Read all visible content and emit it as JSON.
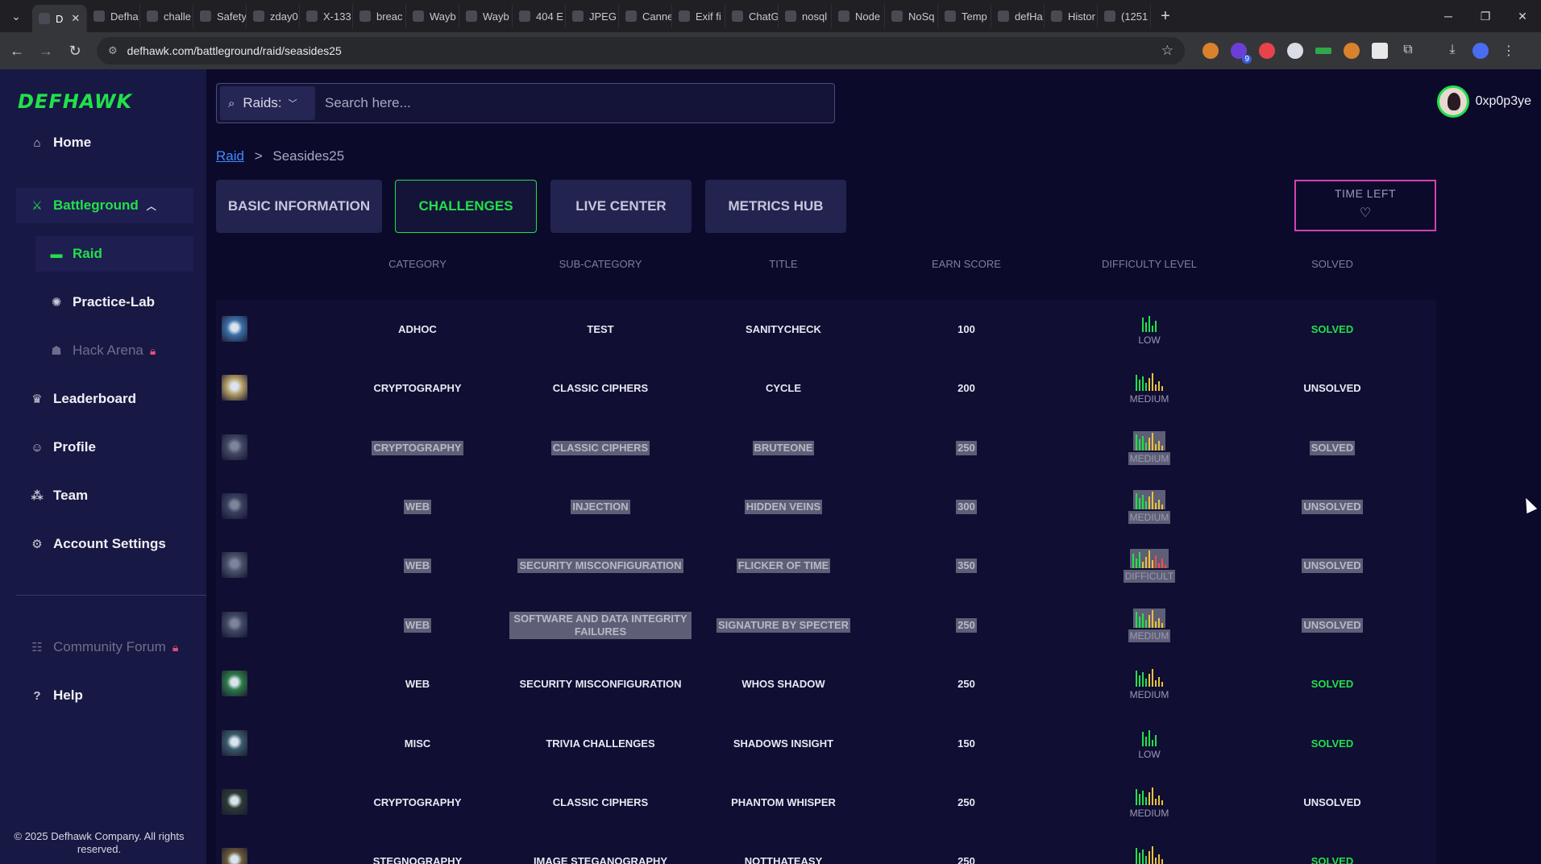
{
  "browser": {
    "tabs": [
      {
        "label": "D",
        "active": true
      },
      {
        "label": "Defha"
      },
      {
        "label": "challe"
      },
      {
        "label": "Safety wa"
      },
      {
        "label": "zday0"
      },
      {
        "label": "X-133"
      },
      {
        "label": "breac"
      },
      {
        "label": "Wayb"
      },
      {
        "label": "Wayb"
      },
      {
        "label": "404 E"
      },
      {
        "label": "JPEG i"
      },
      {
        "label": "Canne"
      },
      {
        "label": "Exif fi"
      },
      {
        "label": "ChatG"
      },
      {
        "label": "nosql"
      },
      {
        "label": "Node"
      },
      {
        "label": "NoSq"
      },
      {
        "label": "Temp"
      },
      {
        "label": "defHa"
      },
      {
        "label": "Histor"
      },
      {
        "label": "(1251"
      }
    ],
    "url": "defhawk.com/battleground/raid/seasides25",
    "extension_badge": "9"
  },
  "brand": {
    "logo": "DEFHAWK",
    "accent": "#22e04a",
    "highlight_border": "#d640b0"
  },
  "sidebar": {
    "items": [
      {
        "label": "Home",
        "icon": "home-icon"
      },
      {
        "label": "Battleground",
        "icon": "battleground-icon",
        "expanded": true
      },
      {
        "label": "Raid",
        "icon": "raid-icon",
        "active": true
      },
      {
        "label": "Practice-Lab",
        "icon": "practice-lab-icon"
      },
      {
        "label": "Hack Arena",
        "icon": "hack-arena-icon",
        "locked": true
      },
      {
        "label": "Leaderboard",
        "icon": "leaderboard-icon"
      },
      {
        "label": "Profile",
        "icon": "profile-icon"
      },
      {
        "label": "Team",
        "icon": "team-icon"
      },
      {
        "label": "Account Settings",
        "icon": "gear-icon"
      },
      {
        "label": "Community Forum",
        "icon": "forum-icon",
        "locked": true
      },
      {
        "label": "Help",
        "icon": "help-icon"
      }
    ],
    "footer": "© 2025 Defhawk Company. All rights reserved."
  },
  "search": {
    "scope": "Raids:",
    "placeholder": "Search here..."
  },
  "user": {
    "name": "0xp0p3ye"
  },
  "breadcrumb": {
    "parent": "Raid",
    "separator": ">",
    "current": "Seasides25"
  },
  "page_tabs": [
    {
      "label": "BASIC INFORMATION"
    },
    {
      "label": "CHALLENGES",
      "active": true
    },
    {
      "label": "LIVE CENTER"
    },
    {
      "label": "METRICS HUB"
    }
  ],
  "time_left": {
    "label": "TIME LEFT"
  },
  "table": {
    "headers": [
      "CATEGORY",
      "SUB-CATEGORY",
      "TITLE",
      "EARN SCORE",
      "DIFFICULTY LEVEL",
      "SOLVED"
    ],
    "rows": [
      {
        "category": "ADHOC",
        "subcategory": "TEST",
        "title": "SANITYCHECK",
        "score": "100",
        "difficulty": "LOW",
        "status": "SOLVED",
        "highlighted": false
      },
      {
        "category": "CRYPTOGRAPHY",
        "subcategory": "CLASSIC CIPHERS",
        "title": "CYCLE",
        "score": "200",
        "difficulty": "MEDIUM",
        "status": "UNSOLVED",
        "highlighted": false
      },
      {
        "category": "CRYPTOGRAPHY",
        "subcategory": "CLASSIC CIPHERS",
        "title": "BRUTEONE",
        "score": "250",
        "difficulty": "MEDIUM",
        "status": "SOLVED",
        "highlighted": true
      },
      {
        "category": "WEB",
        "subcategory": "INJECTION",
        "title": "HIDDEN VEINS",
        "score": "300",
        "difficulty": "MEDIUM",
        "status": "UNSOLVED",
        "highlighted": true
      },
      {
        "category": "WEB",
        "subcategory": "SECURITY MISCONFIGURATION",
        "title": "FLICKER OF TIME",
        "score": "350",
        "difficulty": "DIFFICULT",
        "status": "UNSOLVED",
        "highlighted": true
      },
      {
        "category": "WEB",
        "subcategory": "SOFTWARE AND DATA INTEGRITY FAILURES",
        "title": "SIGNATURE BY SPECTER",
        "score": "250",
        "difficulty": "MEDIUM",
        "status": "UNSOLVED",
        "highlighted": true
      },
      {
        "category": "WEB",
        "subcategory": "SECURITY MISCONFIGURATION",
        "title": "WHOS SHADOW",
        "score": "250",
        "difficulty": "MEDIUM",
        "status": "SOLVED",
        "highlighted": false
      },
      {
        "category": "MISC",
        "subcategory": "TRIVIA CHALLENGES",
        "title": "SHADOWS INSIGHT",
        "score": "150",
        "difficulty": "LOW",
        "status": "SOLVED",
        "highlighted": false
      },
      {
        "category": "CRYPTOGRAPHY",
        "subcategory": "CLASSIC CIPHERS",
        "title": "PHANTOM WHISPER",
        "score": "250",
        "difficulty": "MEDIUM",
        "status": "UNSOLVED",
        "highlighted": false
      },
      {
        "category": "STEGNOGRAPHY",
        "subcategory": "IMAGE STEGANOGRAPHY",
        "title": "NOTTHATEASY",
        "score": "250",
        "difficulty": "MEDIUM",
        "status": "SOLVED",
        "highlighted": false
      }
    ]
  }
}
